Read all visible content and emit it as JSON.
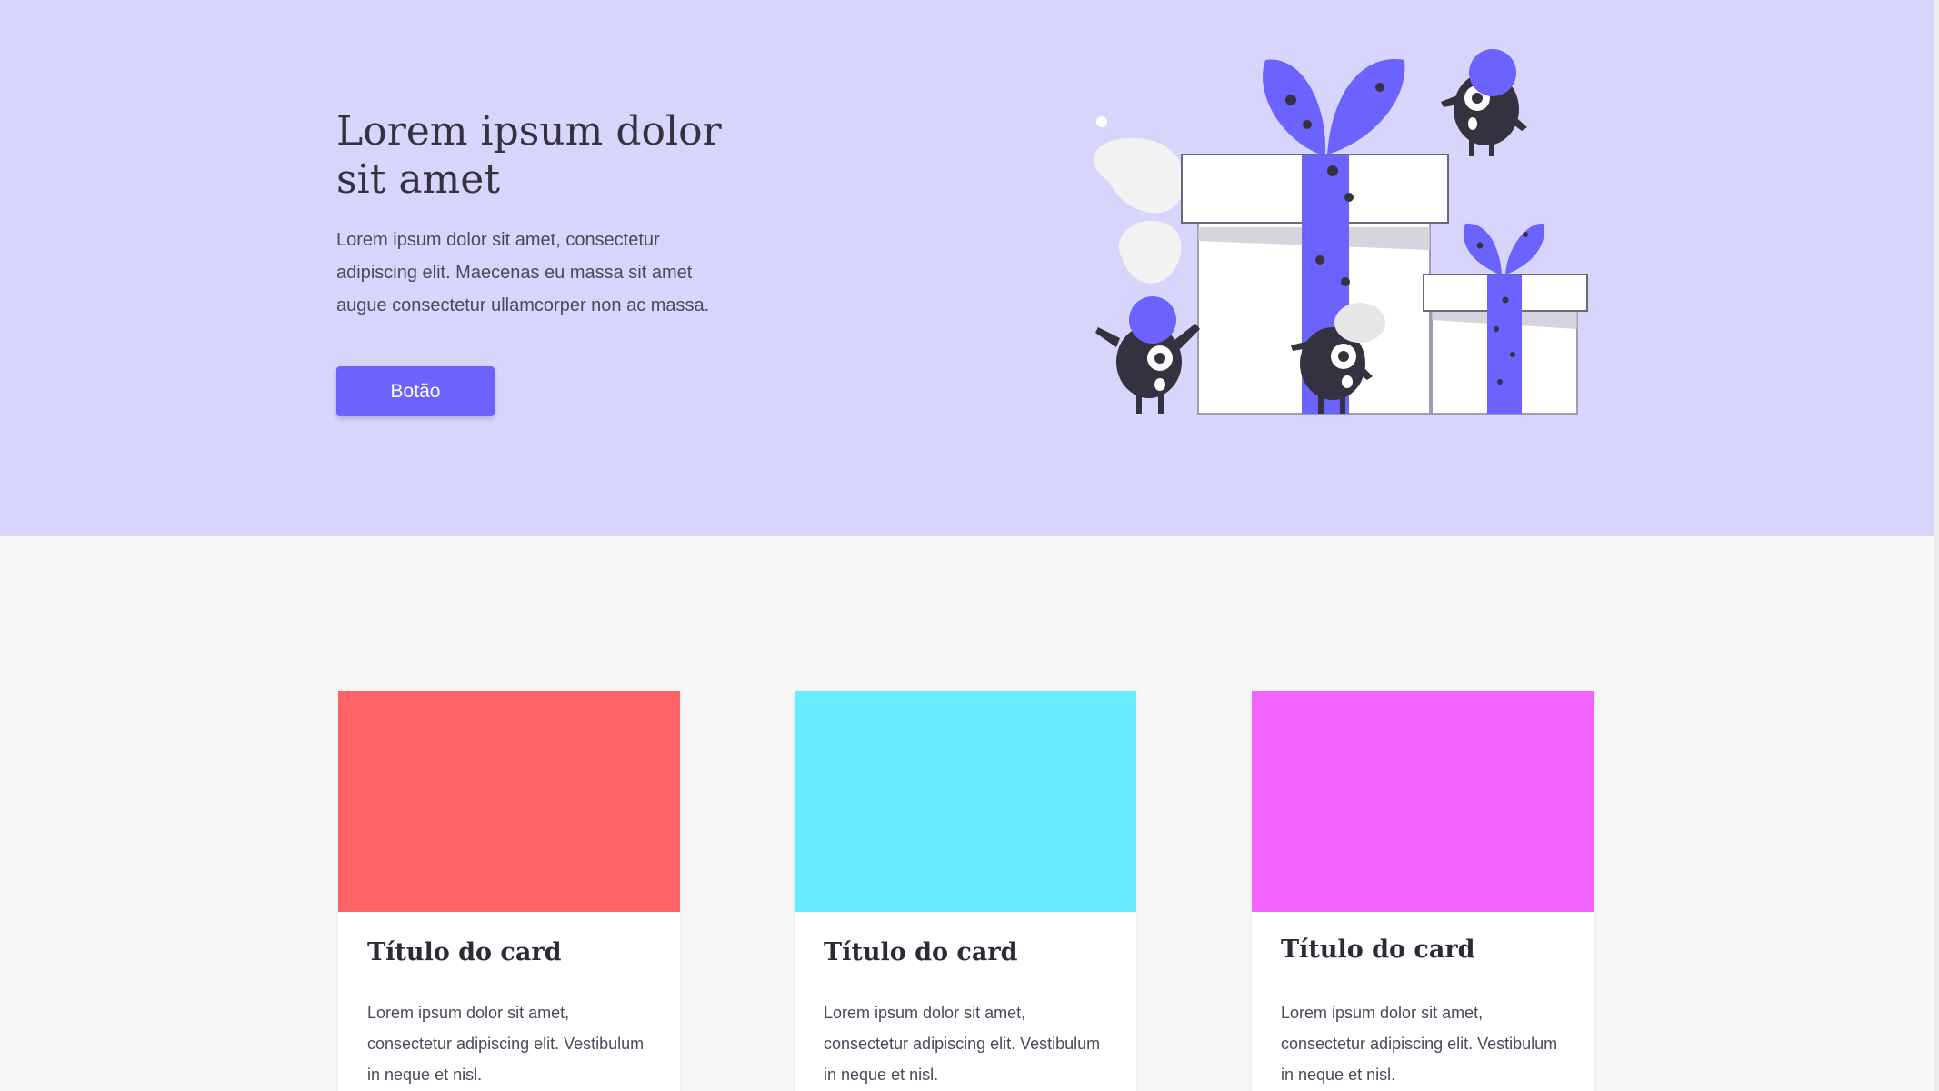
{
  "colors": {
    "hero_background": "#d8d5fd",
    "page_background": "#f7f7f7",
    "accent": "#6c63ff",
    "card_colors": [
      "#ff6363",
      "#66ebff",
      "#f363ff"
    ]
  },
  "hero": {
    "title": "Lorem ipsum dolor sit amet",
    "text": "Lorem ipsum dolor sit amet, consectetur adipiscing elit. Maecenas eu massa sit amet augue consectetur ullamcorper non ac massa.",
    "button_label": "Botão",
    "illustration": "gift-boxes-with-monsters-illustration"
  },
  "cards": [
    {
      "title": "Título do card",
      "text": "Lorem ipsum dolor sit amet, consectetur adipiscing elit. Vestibulum in neque et nisl."
    },
    {
      "title": "Título do card",
      "text": "Lorem ipsum dolor sit amet, consectetur adipiscing elit. Vestibulum in neque et nisl."
    },
    {
      "title": "Título do card",
      "text": "Lorem ipsum dolor sit amet, consectetur adipiscing elit. Vestibulum in neque et nisl."
    }
  ]
}
